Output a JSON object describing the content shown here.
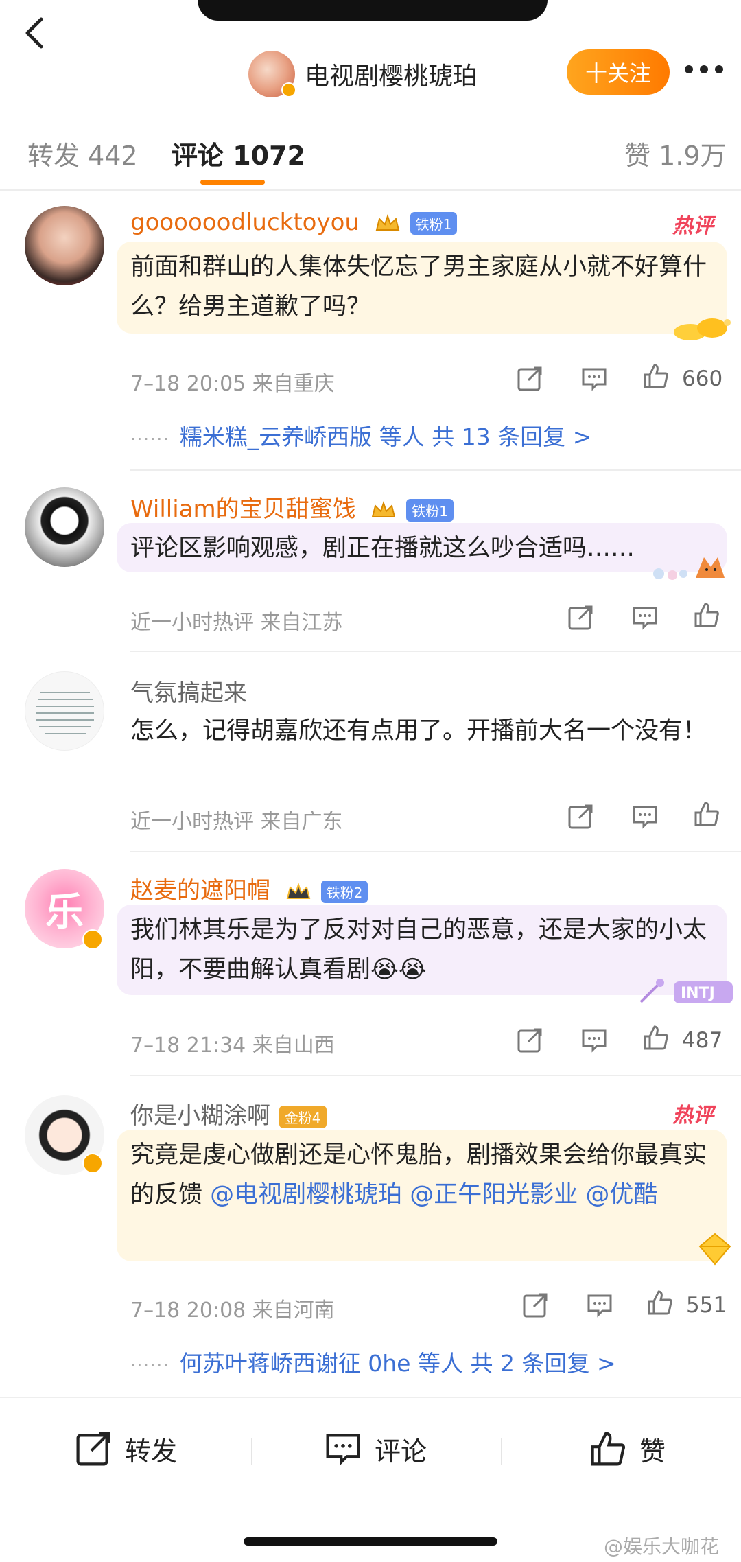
{
  "header": {
    "title": "电视剧樱桃琥珀",
    "follow_label": "十关注"
  },
  "tabs": [
    {
      "label": "转发 442"
    },
    {
      "label": "评论 1072"
    },
    {
      "label": "赞 1.9万"
    }
  ],
  "comments": [
    {
      "user": "goooooodlucktoyou",
      "fan_badge": "铁粉1",
      "hot": "热评",
      "text": "前面和群山的人集体失忆忘了男主家庭从小就不好算什么？给男主道歉了吗？",
      "meta": "7–18 20:05  来自重庆",
      "likes": "660",
      "reply": {
        "prefix": "······",
        "names": "糯米糕_云养峤西版",
        "mid": "等人",
        "count": "共 13 条回复 >"
      }
    },
    {
      "user": "William的宝贝甜蜜饯",
      "fan_badge": "铁粉1",
      "text": "评论区影响观感，剧正在播就这么吵合适吗……",
      "meta": "近一小时热评  来自江苏"
    },
    {
      "user": "气氛搞起来",
      "text": "怎么，记得胡嘉欣还有点用了。开播前大名一个没有！",
      "meta": "近一小时热评  来自广东"
    },
    {
      "user": "赵麦的遮阳帽",
      "fan_badge": "铁粉2",
      "text": "我们林其乐是为了反对对自己的恶意，还是大家的小太阳，不要曲解认真看剧😭😭",
      "meta": "7–18 21:34  来自山西",
      "likes": "487",
      "avatar_text": "乐"
    },
    {
      "user": "你是小糊涂啊",
      "fan_badge": "金粉4",
      "hot": "热评",
      "text": "究竟是虔心做剧还是心怀鬼胎，剧播效果会给你最真实的反馈 ",
      "mentions": "@电视剧樱桃琥珀 @正午阳光影业 @优酷",
      "meta": "7–18 20:08  来自河南",
      "likes": "551",
      "reply": {
        "prefix": "······",
        "names": "何苏叶蒋峤西谢征 0he",
        "mid": "等人",
        "count": "共 2 条回复 >"
      }
    }
  ],
  "bottom": {
    "repost": "转发",
    "comment": "评论",
    "like": "赞"
  },
  "watermark": "@娱乐大咖花",
  "colors": {
    "accent": "#ff8200",
    "link": "#3b6fd4",
    "username": "#e86b0f",
    "hot": "#f0445b"
  }
}
